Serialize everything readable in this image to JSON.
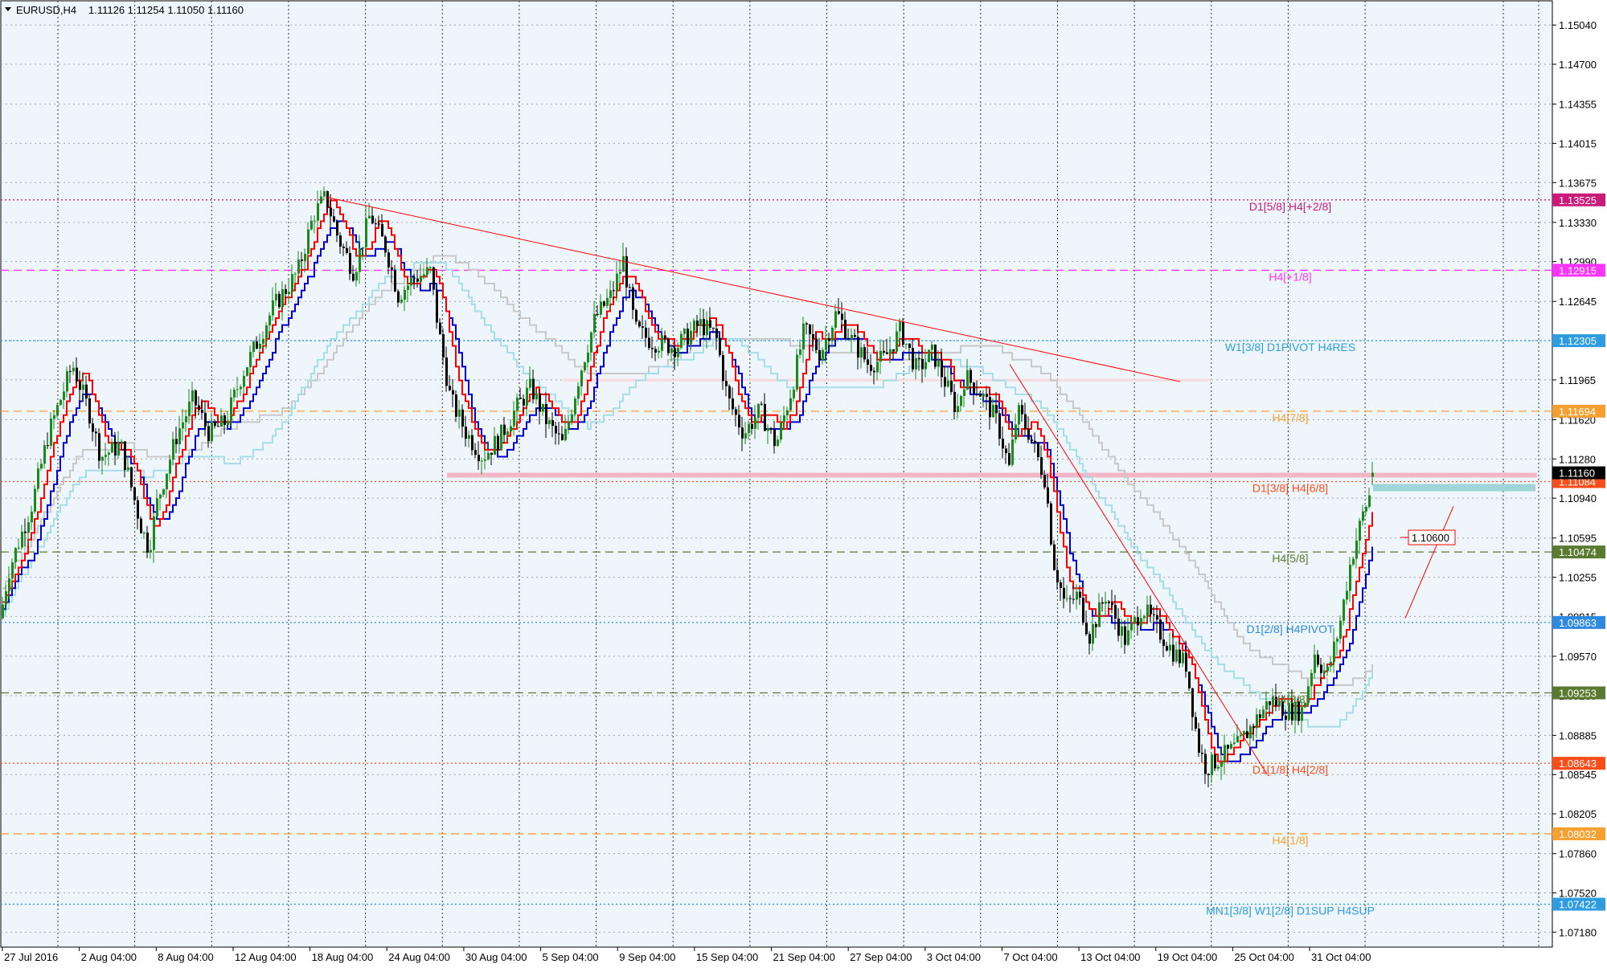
{
  "header": {
    "symbol": "EURUSD,H4",
    "ohlc": "1.11126 1.11254 1.11050 1.11160"
  },
  "chart_data": {
    "type": "candlestick",
    "ylim": [
      1.0705,
      1.1525
    ],
    "y_ticks": [
      "1.15040",
      "1.14700",
      "1.14355",
      "1.14015",
      "1.13675",
      "1.13330",
      "1.12990",
      "1.12645",
      "1.12305",
      "1.11965",
      "1.11620",
      "1.11280",
      "1.10940",
      "1.10595",
      "1.10255",
      "1.09915",
      "1.09570",
      "1.09230",
      "1.08885",
      "1.08545",
      "1.08205",
      "1.07860",
      "1.07520",
      "1.07180"
    ],
    "x_ticks": [
      "27 Jul 2016",
      "2 Aug 04:00",
      "8 Aug 04:00",
      "12 Aug 04:00",
      "18 Aug 04:00",
      "24 Aug 04:00",
      "30 Aug 04:00",
      "5 Sep 04:00",
      "9 Sep 04:00",
      "15 Sep 04:00",
      "21 Sep 04:00",
      "27 Sep 04:00",
      "3 Oct 04:00",
      "7 Oct 04:00",
      "13 Oct 04:00",
      "19 Oct 04:00",
      "25 Oct 04:00",
      "31 Oct 04:00"
    ],
    "grid": true,
    "current_price": "1.11160",
    "levels": [
      {
        "price": 1.13525,
        "tag": "1.13525",
        "label": "D1[5/8] H4[+2/8]",
        "color": "#cc1a7a",
        "dash": "dotted"
      },
      {
        "price": 1.12915,
        "tag": "1.12915",
        "label": "H4[+1/8]",
        "color": "#ff33ff",
        "dash": "dashed"
      },
      {
        "price": 1.12305,
        "tag": "1.12305",
        "label": "W1[3/8] D1PIVOT H4RES",
        "color": "#2d9ce0",
        "dash": "dotted"
      },
      {
        "price": 1.11694,
        "tag": "1.11694",
        "label": "H4[7/8]",
        "color": "#f5a030",
        "dash": "dashed"
      },
      {
        "price": 1.11084,
        "tag": "1.11084",
        "label": "D1[3/8] H4[6/8]",
        "color": "#ff4d1a",
        "dash": "dotted"
      },
      {
        "price": 1.10474,
        "tag": "1.10474",
        "label": "H4[5/8]",
        "color": "#5a7a30",
        "dash": "dashed"
      },
      {
        "price": 1.09863,
        "tag": "1.09863",
        "label": "D1[2/8] H4PIVOT",
        "color": "#2d8ae0",
        "dash": "dotted"
      },
      {
        "price": 1.09253,
        "tag": "1.09253",
        "label": "H4[3/8]",
        "color": "#5a7a30",
        "dash": "dashed"
      },
      {
        "price": 1.08643,
        "tag": "1.08643",
        "label": "D1[1/8] H4[2/8]",
        "color": "#ff4d1a",
        "dash": "dotted"
      },
      {
        "price": 1.08032,
        "tag": "1.08032",
        "label": "H4[1/8]",
        "color": "#f5a030",
        "dash": "dashed"
      },
      {
        "price": 1.07422,
        "tag": "1.07422",
        "label": "MN1[3/8] W1[2/8] D1SUP H4SUP",
        "color": "#2d9ce0",
        "dash": "dotted"
      }
    ],
    "annotation_price": "1.10600",
    "colors": {
      "background": "#eef6fc",
      "grid": "#000000",
      "candle_bull": "#1a8a1a",
      "candle_bear": "#000000",
      "ma_red": "#ff0000",
      "ma_blue": "#0000cc",
      "ma_cyan": "#a6dde8",
      "ma_gray": "#c8c8c8",
      "trendline": "#ff0000",
      "current_tag": "#000000"
    }
  }
}
